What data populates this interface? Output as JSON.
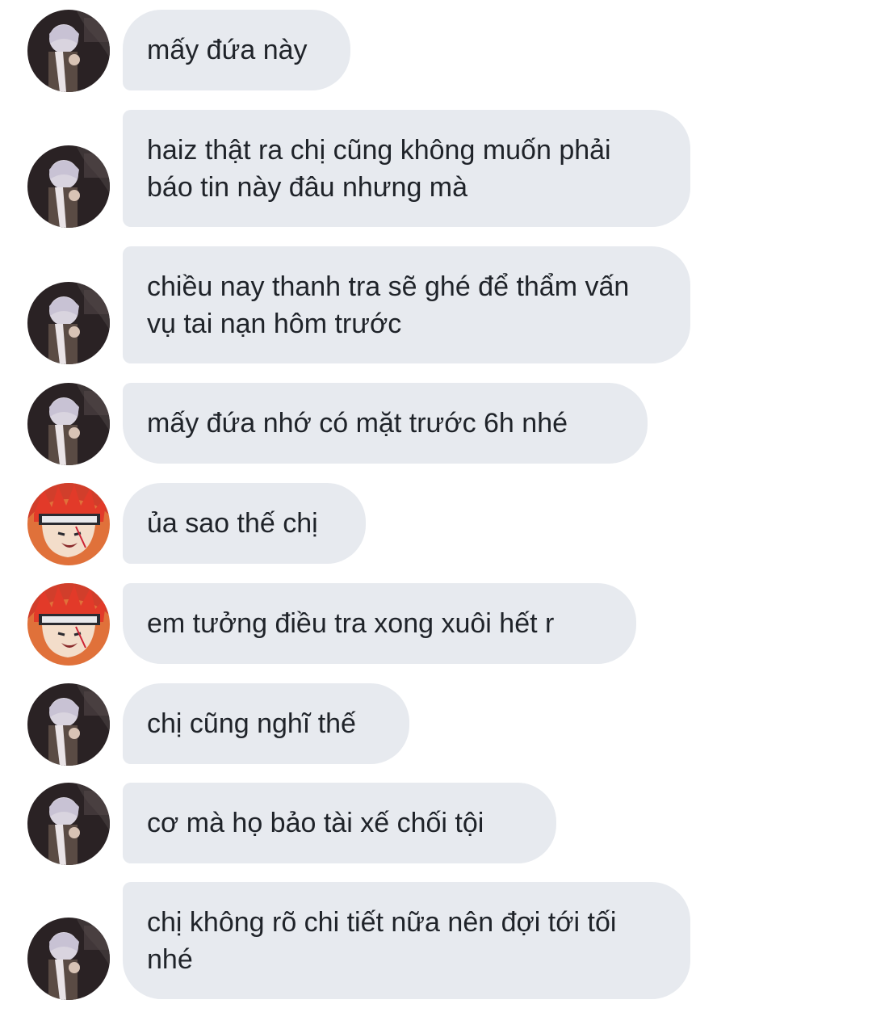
{
  "conversation": {
    "messages": [
      {
        "sender": "silver-hair",
        "text": "mấy đứa này"
      },
      {
        "sender": "silver-hair",
        "text": "haiz thật ra chị cũng không muốn phải báo tin này đâu nhưng mà"
      },
      {
        "sender": "silver-hair",
        "text": "chiều nay thanh tra sẽ ghé để thẩm vấn vụ tai nạn hôm trước"
      },
      {
        "sender": "silver-hair",
        "text": "mấy đứa nhớ có mặt trước 6h nhé"
      },
      {
        "sender": "red-hair",
        "text": "ủa sao thế chị"
      },
      {
        "sender": "red-hair",
        "text": "em tưởng điều tra xong xuôi hết r"
      },
      {
        "sender": "silver-hair",
        "text": "chị cũng nghĩ thế"
      },
      {
        "sender": "silver-hair",
        "text": "cơ mà họ bảo tài xế chối tội"
      },
      {
        "sender": "silver-hair",
        "text": "chị không rõ chi tiết nữa nên đợi tới tối nhé"
      }
    ]
  },
  "colors": {
    "bubble_bg": "#e7eaef",
    "text": "#1f2329",
    "page_bg": "#ffffff"
  },
  "icons": {
    "silver_avatar": "avatar-silver-hair-character",
    "red_avatar": "avatar-red-hair-character"
  }
}
